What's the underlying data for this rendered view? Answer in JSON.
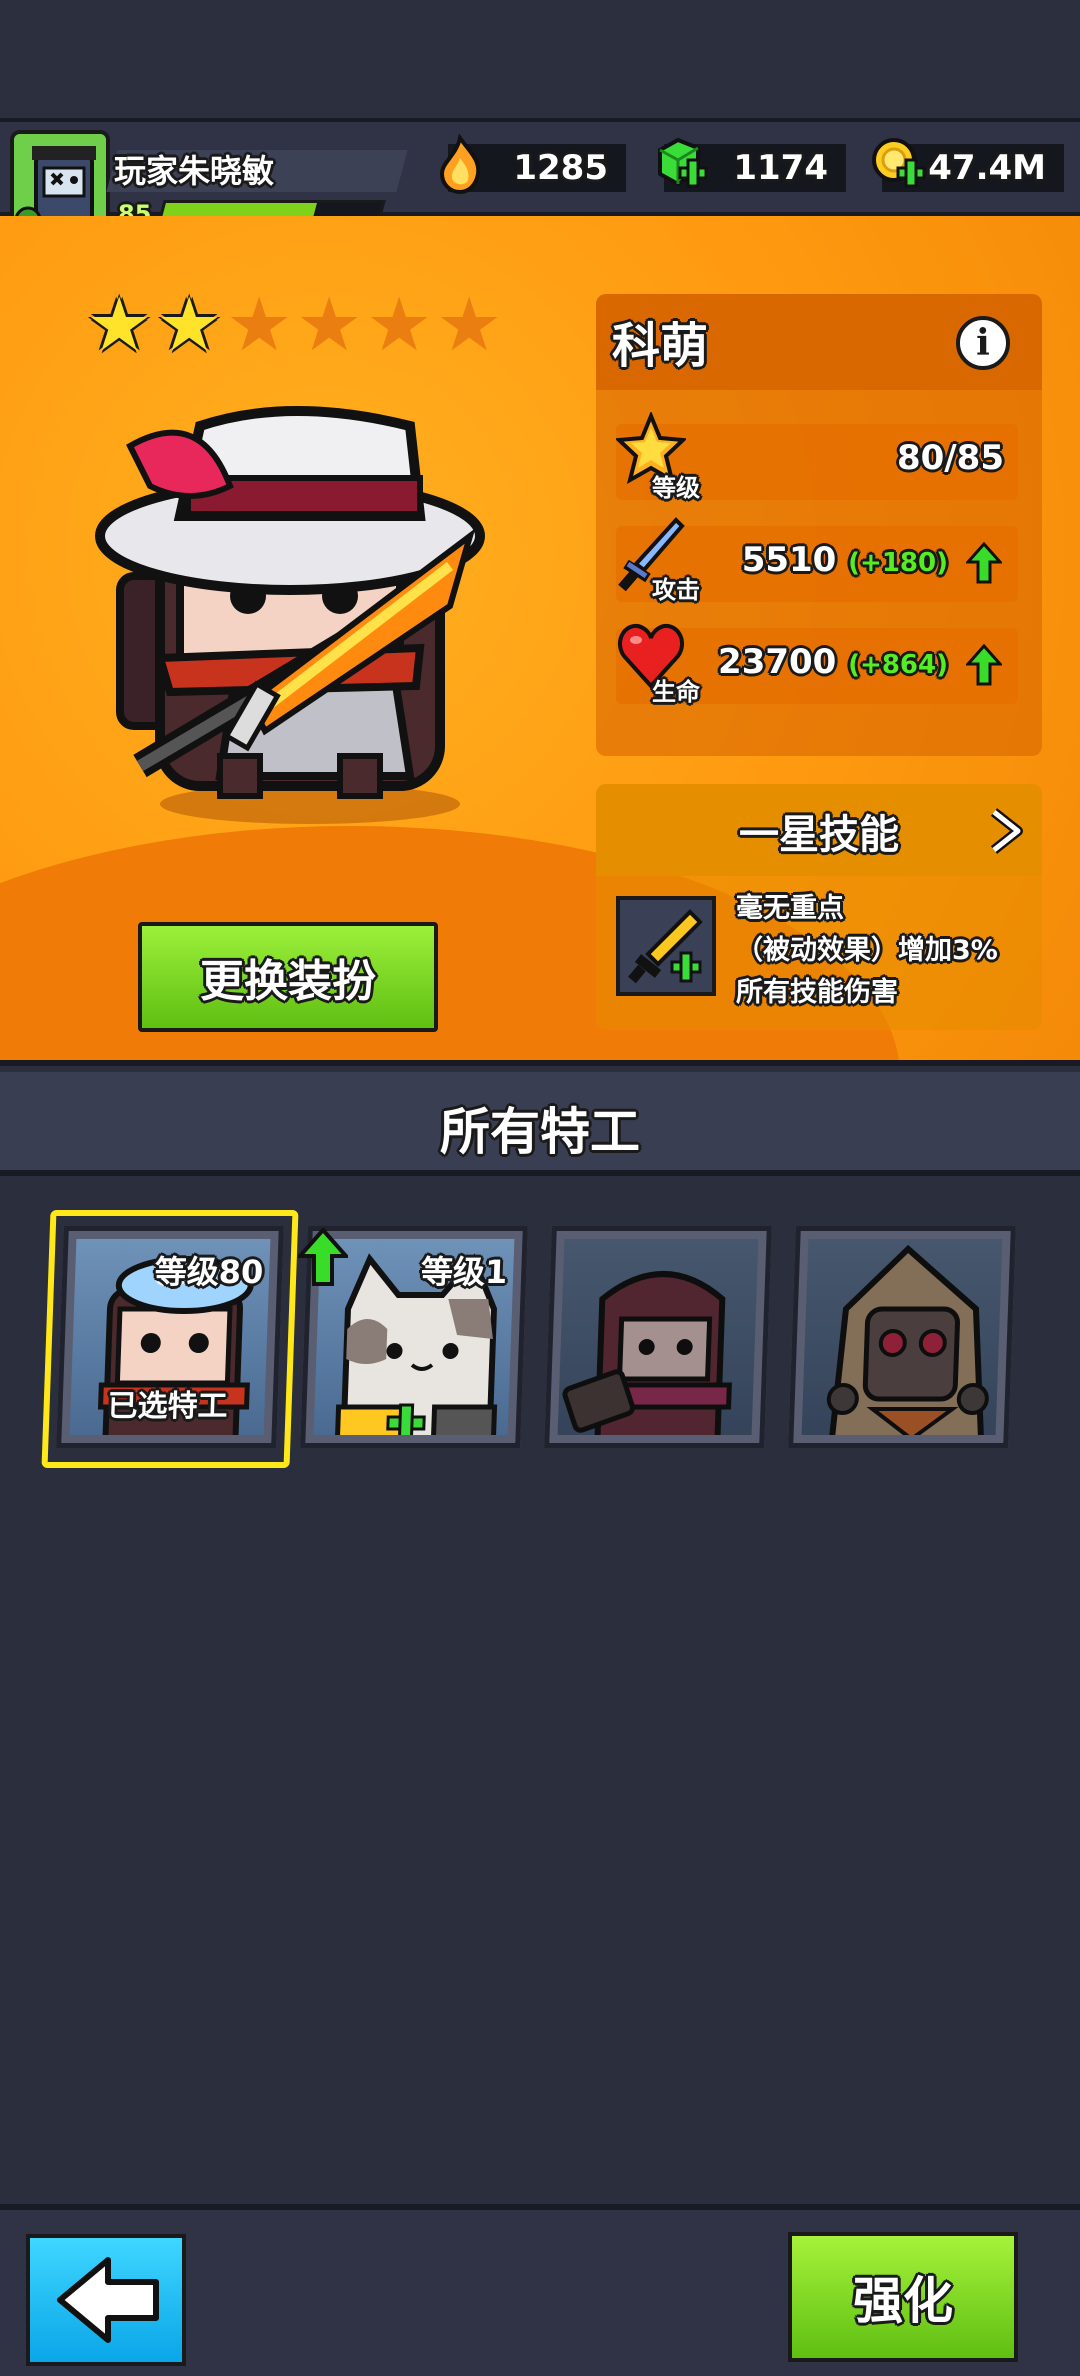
{
  "player": {
    "name": "玩家朱晓敏",
    "level": "85",
    "xp_fraction": 0.7
  },
  "currencies": [
    {
      "name": "fire-essence",
      "value": "1285"
    },
    {
      "name": "green-gem",
      "value": "1174"
    },
    {
      "name": "gold-coin",
      "value": "47.4M"
    }
  ],
  "hero": {
    "stars_filled": 2,
    "stars_total": 6,
    "outfit_button": "更换装扮",
    "name": "科萌",
    "stats": {
      "level": {
        "label": "等级",
        "value": "80/85"
      },
      "attack": {
        "label": "攻击",
        "value": "5510",
        "bonus": "(+180)"
      },
      "hp": {
        "label": "生命",
        "value": "23700",
        "bonus": "(+864)"
      }
    },
    "skill": {
      "title": "一星技能",
      "line1": "毫无重点",
      "line2": "（被动效果）增加3%",
      "line3": "所有技能伤害"
    }
  },
  "agents": {
    "title": "所有特工",
    "cards": [
      {
        "level": "等级80",
        "status": "已选特工"
      },
      {
        "level": "等级1",
        "status": ""
      },
      {
        "level": "",
        "status": ""
      },
      {
        "level": "",
        "status": ""
      }
    ]
  },
  "bottom": {
    "upgrade_button": "强化"
  },
  "colors": {
    "accent_orange": "#ff9a10",
    "green_button": "#7fd21a",
    "blue_button": "#0aa6e8",
    "bonus_green": "#55ee22",
    "star_yellow": "#ffe22a"
  }
}
